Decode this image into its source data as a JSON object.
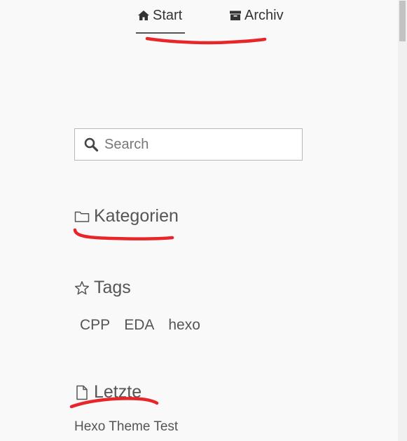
{
  "nav": {
    "items": [
      {
        "label": "Start",
        "icon": "home-icon",
        "active": true
      },
      {
        "label": "Archiv",
        "icon": "archive-icon",
        "active": false
      }
    ]
  },
  "search": {
    "placeholder": "Search",
    "value": ""
  },
  "widgets": {
    "kategorien": {
      "title": "Kategorien",
      "icon": "folder-icon"
    },
    "tags": {
      "title": "Tags",
      "icon": "star-icon",
      "items": [
        "CPP",
        "EDA",
        "hexo"
      ]
    },
    "letzte": {
      "title": "Letzte",
      "icon": "file-icon",
      "items": [
        "Hexo Theme Test"
      ]
    }
  },
  "colors": {
    "annotation": "#e8262a",
    "text": "#555555",
    "background": "#f9f9f9"
  }
}
